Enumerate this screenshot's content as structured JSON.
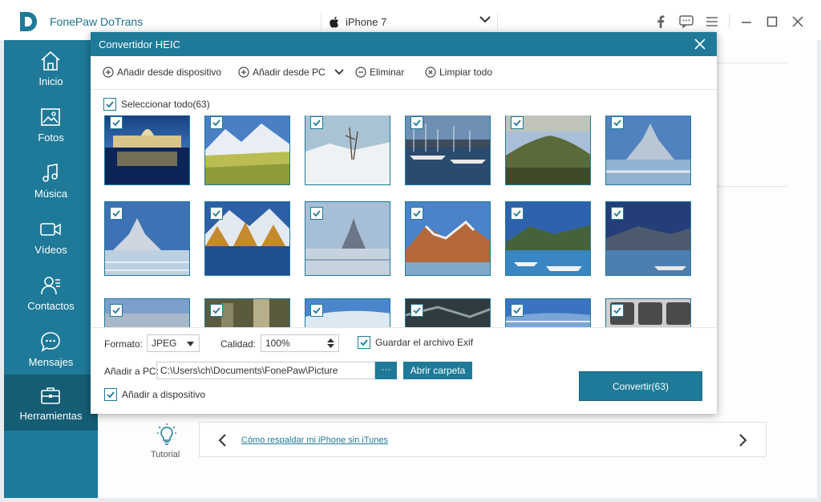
{
  "app": {
    "title": "FonePaw DoTrans"
  },
  "device": {
    "name": "iPhone 7"
  },
  "sidebar": {
    "items": [
      {
        "label": "Inicio",
        "icon": "home-icon"
      },
      {
        "label": "Fotos",
        "icon": "photo-icon"
      },
      {
        "label": "Música",
        "icon": "music-icon"
      },
      {
        "label": "Vídeos",
        "icon": "video-icon"
      },
      {
        "label": "Contactos",
        "icon": "contacts-icon"
      },
      {
        "label": "Mensajes",
        "icon": "message-icon"
      },
      {
        "label": "Herramientas",
        "icon": "toolbox-icon"
      }
    ],
    "active": "Herramientas"
  },
  "dialog": {
    "title": "Convertidor HEIC",
    "toolbar": {
      "add_device": "Añadir desde dispositivo",
      "add_pc": "Añadir desde PC",
      "delete": "Eliminar",
      "clear_all": "Limpiar todo"
    },
    "select_all": "Seleccionar todo(63)",
    "settings": {
      "format_label": "Formato:",
      "format_value": "JPEG",
      "quality_label": "Calidad:",
      "quality_value": "100%",
      "exif_label": "Guardar el archivo Exif",
      "add_pc_label": "Añadir a PC:",
      "path_value": "C:\\Users\\ch\\Documents\\FonePaw\\Picture",
      "browse_label": "···",
      "open_folder": "Abrir carpeta",
      "add_device_label": "Añadir a dispositivo",
      "convert_button": "Convertir(63)"
    }
  },
  "tutorial": {
    "label": "Tutorial",
    "link": "Cómo respaldar mi iPhone sin iTunes"
  },
  "colors": {
    "accent": "#1e7a98",
    "sidebar_active": "#155d75"
  }
}
